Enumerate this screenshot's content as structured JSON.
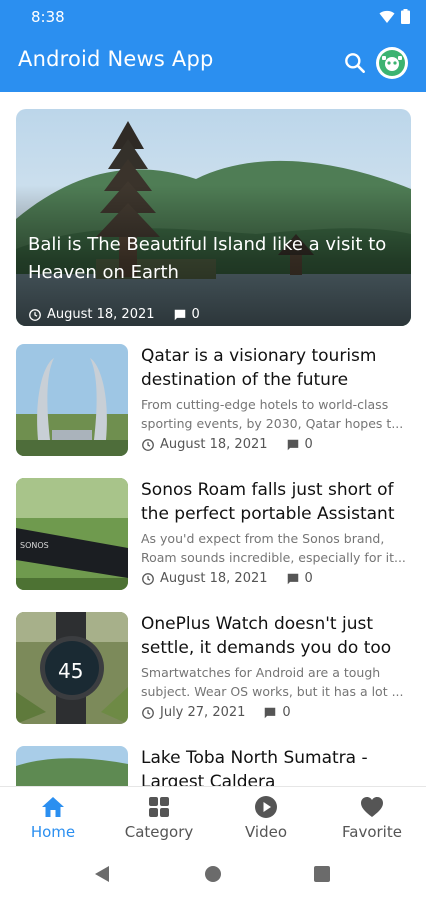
{
  "status": {
    "time": "8:38"
  },
  "app": {
    "title": "Android News App"
  },
  "featured": {
    "title": "Bali is The Beautiful Island like a visit to Heaven on Earth",
    "date": "August 18, 2021",
    "comments": "0"
  },
  "articles": [
    {
      "title": "Qatar is a visionary tourism destination of the future",
      "excerpt_line1": "From cutting-edge hotels to world-class",
      "excerpt_line2": "sporting events, by 2030, Qatar hopes t...",
      "date": "August 18, 2021",
      "comments": "0"
    },
    {
      "title": "Sonos Roam falls just short of the perfect portable Assistant",
      "excerpt_line1": "As you'd expect from the Sonos brand,",
      "excerpt_line2": "Roam sounds incredible, especially for it...",
      "date": "August 18, 2021",
      "comments": "0",
      "thumb_text": "SONOS"
    },
    {
      "title": "OnePlus Watch doesn't just settle, it demands you do too",
      "excerpt_line1": "Smartwatches for Android are a tough",
      "excerpt_line2": "subject. Wear OS works, but it has a lot ...",
      "date": "July 27, 2021",
      "comments": "0",
      "thumb_text": "45"
    },
    {
      "title": "Lake Toba North Sumatra - Largest Caldera"
    }
  ],
  "bottom_nav": [
    {
      "label": "Home",
      "icon": "home-icon",
      "active": true
    },
    {
      "label": "Category",
      "icon": "grid-icon",
      "active": false
    },
    {
      "label": "Video",
      "icon": "play-circle-icon",
      "active": false
    },
    {
      "label": "Favorite",
      "icon": "heart-icon",
      "active": false
    }
  ],
  "colors": {
    "primary": "#2b8ff0",
    "meta_text": "#555555",
    "excerpt_text": "#757575"
  }
}
